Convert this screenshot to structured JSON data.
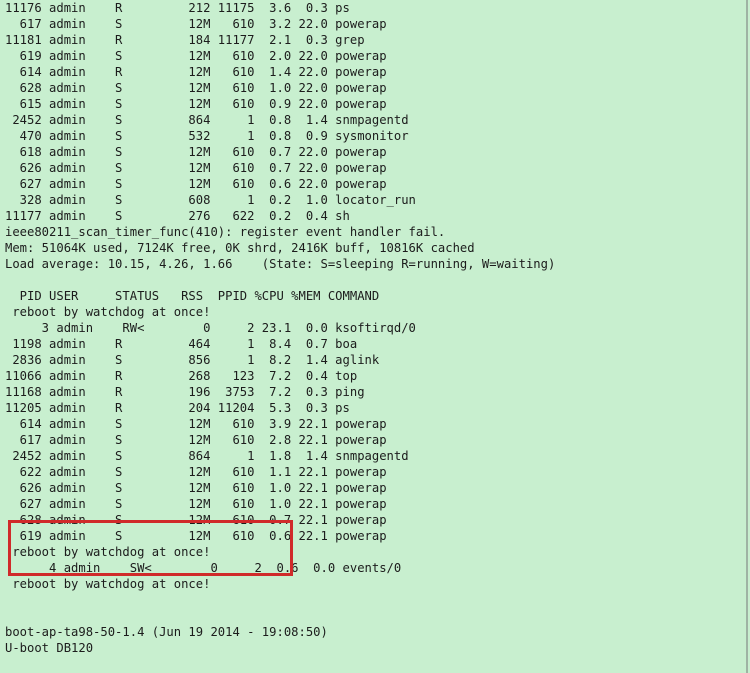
{
  "terminal": {
    "lines": [
      "11176 admin    R         212 11175  3.6  0.3 ps",
      "  617 admin    S         12M   610  3.2 22.0 powerap",
      "11181 admin    R         184 11177  2.1  0.3 grep",
      "  619 admin    S         12M   610  2.0 22.0 powerap",
      "  614 admin    R         12M   610  1.4 22.0 powerap",
      "  628 admin    S         12M   610  1.0 22.0 powerap",
      "  615 admin    S         12M   610  0.9 22.0 powerap",
      " 2452 admin    S         864     1  0.8  1.4 snmpagentd",
      "  470 admin    S         532     1  0.8  0.9 sysmonitor",
      "  618 admin    S         12M   610  0.7 22.0 powerap",
      "  626 admin    S         12M   610  0.7 22.0 powerap",
      "  627 admin    S         12M   610  0.6 22.0 powerap",
      "  328 admin    S         608     1  0.2  1.0 locator_run",
      "11177 admin    S         276   622  0.2  0.4 sh",
      "ieee80211_scan_timer_func(410): register event handler fail.",
      "Mem: 51064K used, 7124K free, 0K shrd, 2416K buff, 10816K cached",
      "Load average: 10.15, 4.26, 1.66    (State: S=sleeping R=running, W=waiting)",
      "",
      "  PID USER     STATUS   RSS  PPID %CPU %MEM COMMAND",
      " reboot by watchdog at once!",
      "     3 admin    RW<        0     2 23.1  0.0 ksoftirqd/0",
      " 1198 admin    R         464     1  8.4  0.7 boa",
      " 2836 admin    S         856     1  8.2  1.4 aglink",
      "11066 admin    R         268   123  7.2  0.4 top",
      "11168 admin    R         196  3753  7.2  0.3 ping",
      "11205 admin    R         204 11204  5.3  0.3 ps",
      "  614 admin    S         12M   610  3.9 22.1 powerap",
      "  617 admin    S         12M   610  2.8 22.1 powerap",
      " 2452 admin    S         864     1  1.8  1.4 snmpagentd",
      "  622 admin    S         12M   610  1.1 22.1 powerap",
      "  626 admin    S         12M   610  1.0 22.1 powerap",
      "  627 admin    S         12M   610  1.0 22.1 powerap",
      "  628 admin    S         12M   610  0.7 22.1 powerap",
      "  619 admin    S         12M   610  0.6 22.1 powerap",
      " reboot by watchdog at once!",
      "      4 admin    SW<        0     2  0.6  0.0 events/0",
      " reboot by watchdog at once!",
      "",
      "",
      "boot-ap-ta98-50-1.4 (Jun 19 2014 - 19:08:50)",
      "U-boot DB120"
    ]
  }
}
